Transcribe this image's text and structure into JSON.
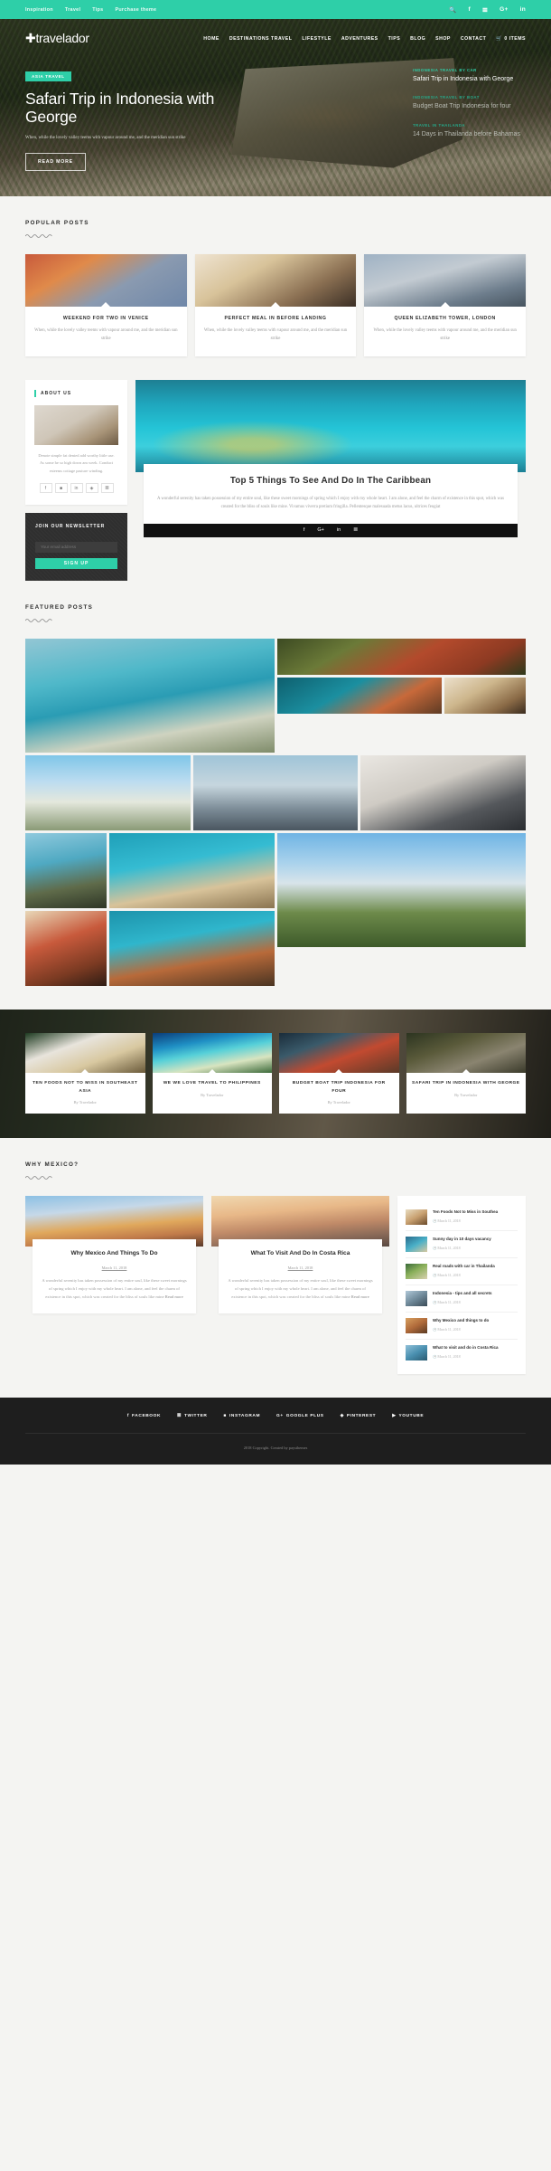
{
  "topbar": {
    "links": [
      "Inspiration",
      "Travel",
      "Tips",
      "Purchase theme"
    ],
    "social": [
      "search-icon",
      "facebook-icon",
      "twitter-icon",
      "google-plus-icon",
      "linkedin-icon"
    ],
    "accent": "#2ecfa8"
  },
  "header": {
    "logo": "travelador",
    "nav": [
      "HOME",
      "DESTINATIONS TRAVEL",
      "LIFESTYLE",
      "ADVENTURES",
      "TIPS",
      "BLOG",
      "SHOP",
      "CONTACT"
    ],
    "cart": "0 ITEMS"
  },
  "hero": {
    "category": "ASIA TRAVEL",
    "title": "Safari Trip in Indonesia with George",
    "excerpt": "When, while the lovely valley teems with vapour around me, and the meridian sun strike",
    "button": "READ MORE",
    "side_posts": [
      {
        "category": "INDONESIA TRAVEL BY CAR",
        "title": "Safari Trip in Indonesia with George"
      },
      {
        "category": "INDONESIA TRAVEL BY BOAT",
        "title": "Budget Boat Trip Indonesia for four"
      },
      {
        "category": "TRAVEL IN THAILANDA",
        "title": "14 Days in Thailanda before Bahamas"
      }
    ]
  },
  "popular": {
    "heading": "POPULAR POSTS",
    "cards": [
      {
        "title": "WEEKEND FOR TWO IN VENICE",
        "text": "When, while the lovely valley teems with vapour around me, and the meridian sun strike"
      },
      {
        "title": "PERFECT MEAL IN BEFORE LANDING",
        "text": "When, while the lovely valley teems with vapour around me, and the meridian sun strike"
      },
      {
        "title": "QUEEN ELIZABETH TOWER, LONDON",
        "text": "When, while the lovely valley teems with vapour around me, and the meridian sun strike"
      }
    ]
  },
  "about": {
    "label": "ABOUT US",
    "text": "Denote simple fat denied add worthy little use. As some he so high down am week. Conduct esteems cottage pasture winding.",
    "social": [
      "facebook-icon",
      "instagram-icon",
      "linkedin-icon",
      "pinterest-icon",
      "twitter-icon"
    ]
  },
  "newsletter": {
    "title": "JOIN OUR NEWSLETTER",
    "placeholder": "Your email address",
    "value": "",
    "button": "SIGN UP"
  },
  "feature": {
    "title": "Top 5 Things To See And Do In The Caribbean",
    "text": "A wonderful serenity has taken possession of my entire soul, like these sweet mornings of spring which I enjoy with my whole heart. I am alone, and feel the charm of existence in this spot, which was created for the bliss of souls like mine. Vivamus viverra pretium fringilla. Pellentesque malesuada metus lacus, ultrices feugiat",
    "social": [
      "facebook-icon",
      "google-plus-icon",
      "linkedin-icon",
      "twitter-icon"
    ]
  },
  "featured_posts": {
    "heading": "FEATURED POSTS",
    "tiles": [
      "thailand-beach-boats",
      "jeep-jungle",
      "longtail-boat-sunset",
      "food-hands",
      "eiffel-tower",
      "big-ben-bridge",
      "traveler-suitcase",
      "island-rocks",
      "turtle-underwater",
      "mountain-hiker",
      "food-plate",
      "boat-turquoise"
    ]
  },
  "carousel": {
    "cards": [
      {
        "title": "TEN FOODS NOT TO MISS IN SOUTHEAST ASIA",
        "by": "By Travelador"
      },
      {
        "title": "WE WE LOVE TRAVEL TO PHILIPPINES",
        "by": "By Travelador"
      },
      {
        "title": "BUDGET BOAT TRIP INDONESIA FOR FOUR",
        "by": "By Travelador"
      },
      {
        "title": "SAFARI TRIP IN INDONESIA WITH GEORGE",
        "by": "By Travelador"
      }
    ]
  },
  "why_mexico": {
    "heading": "WHY MEXICO?",
    "cards": [
      {
        "title": "Why Mexico And Things To Do",
        "date": "March 11, 2018",
        "text": "A wonderful serenity has taken possession of my entire soul, like these sweet mornings of spring which I enjoy with my whole heart. I am alone, and feel the charm of existence in this spot, which was created for the bliss of souls like mine",
        "more": "Read more"
      },
      {
        "title": "What To Visit And Do In Costa Rica",
        "date": "March 11, 2018",
        "text": "A wonderful serenity has taken possession of my entire soul, like these sweet mornings of spring which I enjoy with my whole heart. I am alone, and feel the charm of existence in this spot, which was created for the bliss of souls like mine",
        "more": "Read more"
      }
    ],
    "sidebar": [
      {
        "title": "Ten Foods Not to Miss in Southea",
        "date": "March 11, 2018"
      },
      {
        "title": "Sunny day in 10 days vacancy",
        "date": "March 11, 2018"
      },
      {
        "title": "Real roads with car in Thailanda",
        "date": "March 11, 2018"
      },
      {
        "title": "Indonesia - tips and all secrets",
        "date": "March 11, 2018"
      },
      {
        "title": "Why Mexico and things to do",
        "date": "March 11, 2018"
      },
      {
        "title": "What to visit and do in Costa Rica",
        "date": "March 11, 2018"
      }
    ]
  },
  "footer": {
    "social": [
      "FACEBOOK",
      "TWITTER",
      "INSTAGRAM",
      "GOOGLE PLUS",
      "PINTEREST",
      "YOUTUBE"
    ],
    "copyright": "2018 Copyright. Created by paysthemes"
  }
}
